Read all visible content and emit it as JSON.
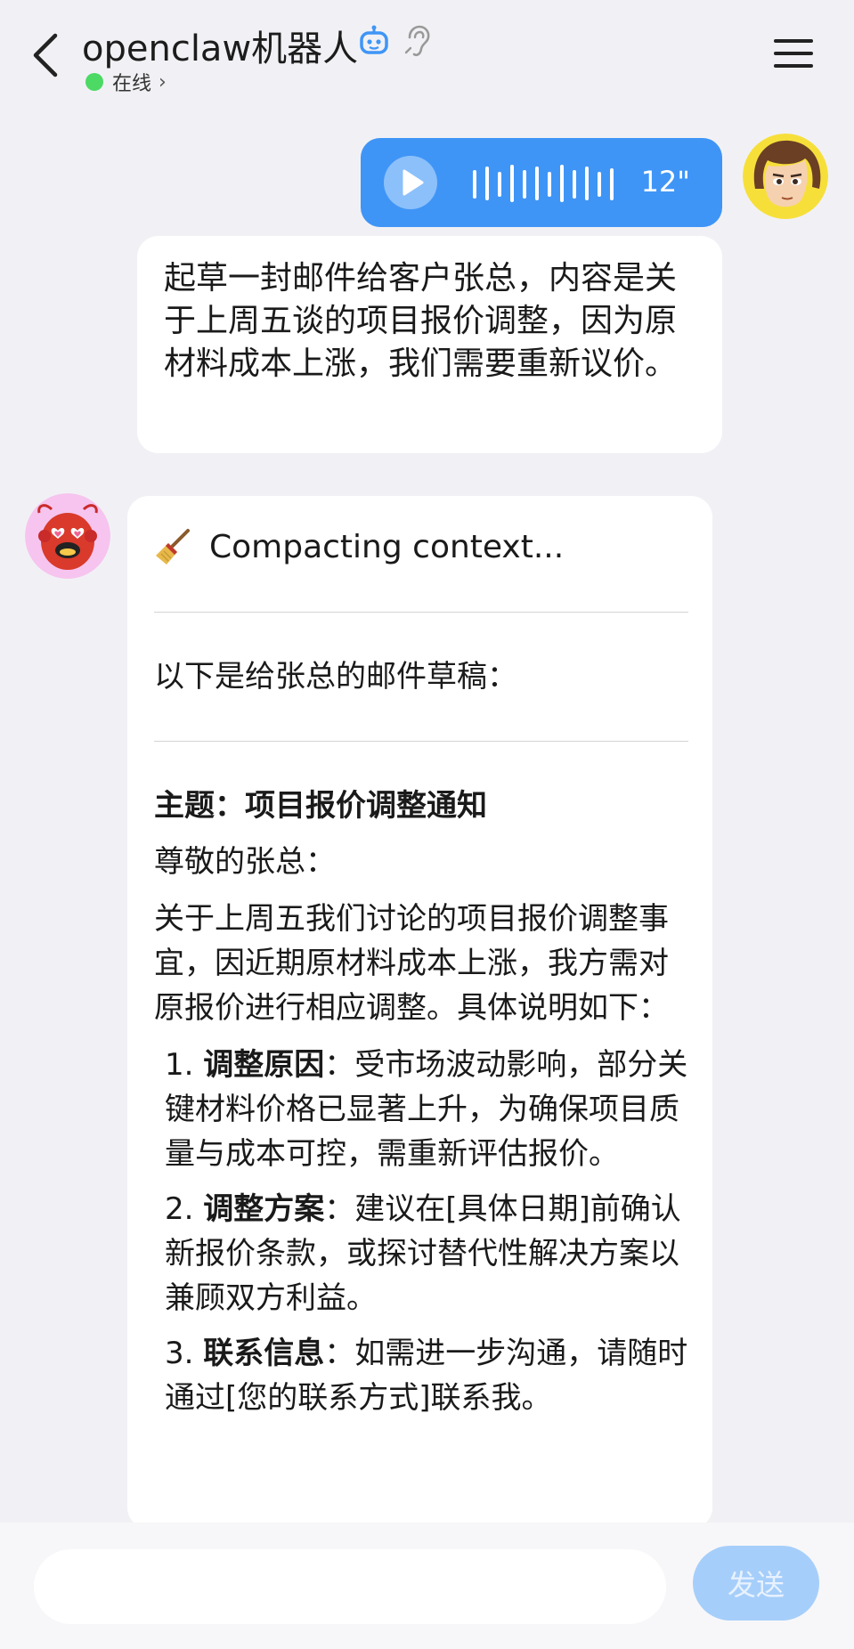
{
  "header": {
    "title": "openclaw机器人",
    "status": "在线",
    "icons": [
      "back-arrow-icon",
      "robot-badge-icon",
      "ear-icon",
      "menu-icon"
    ]
  },
  "messages": {
    "voice": {
      "duration": "12\""
    },
    "transcript": "起草一封邮件给客户张总，内容是关于上周五谈的项目报价调整，因为原材料成本上涨，我们需要重新议价。",
    "reply": {
      "status_text": "Compacting context...",
      "intro": "以下是给张总的邮件草稿：",
      "subject": "主题：项目报价调整通知",
      "greeting": "尊敬的张总：",
      "body": "关于上周五我们讨论的项目报价调整事宜，因近期原材料成本上涨，我方需对原报价进行相应调整。具体说明如下：",
      "items": [
        {
          "num": "1.",
          "label": "调整原因",
          "text": "：受市场波动影响，部分关键材料价格已显著上升，为确保项目质量与成本可控，需重新评估报价。"
        },
        {
          "num": "2.",
          "label": "调整方案",
          "text": "：建议在[具体日期]前确认新报价条款，或探讨替代性解决方案以兼顾双方利益。"
        },
        {
          "num": "3.",
          "label": "联系信息",
          "text": "：如需进一步沟通，请随时通过[您的联系方式]联系我。"
        }
      ]
    }
  },
  "input": {
    "placeholder": "",
    "send_label": "发送"
  },
  "colors": {
    "accent": "#3f95f6",
    "online": "#4cd964",
    "background": "#f1f1f5",
    "send_disabled": "#a6cefa"
  }
}
